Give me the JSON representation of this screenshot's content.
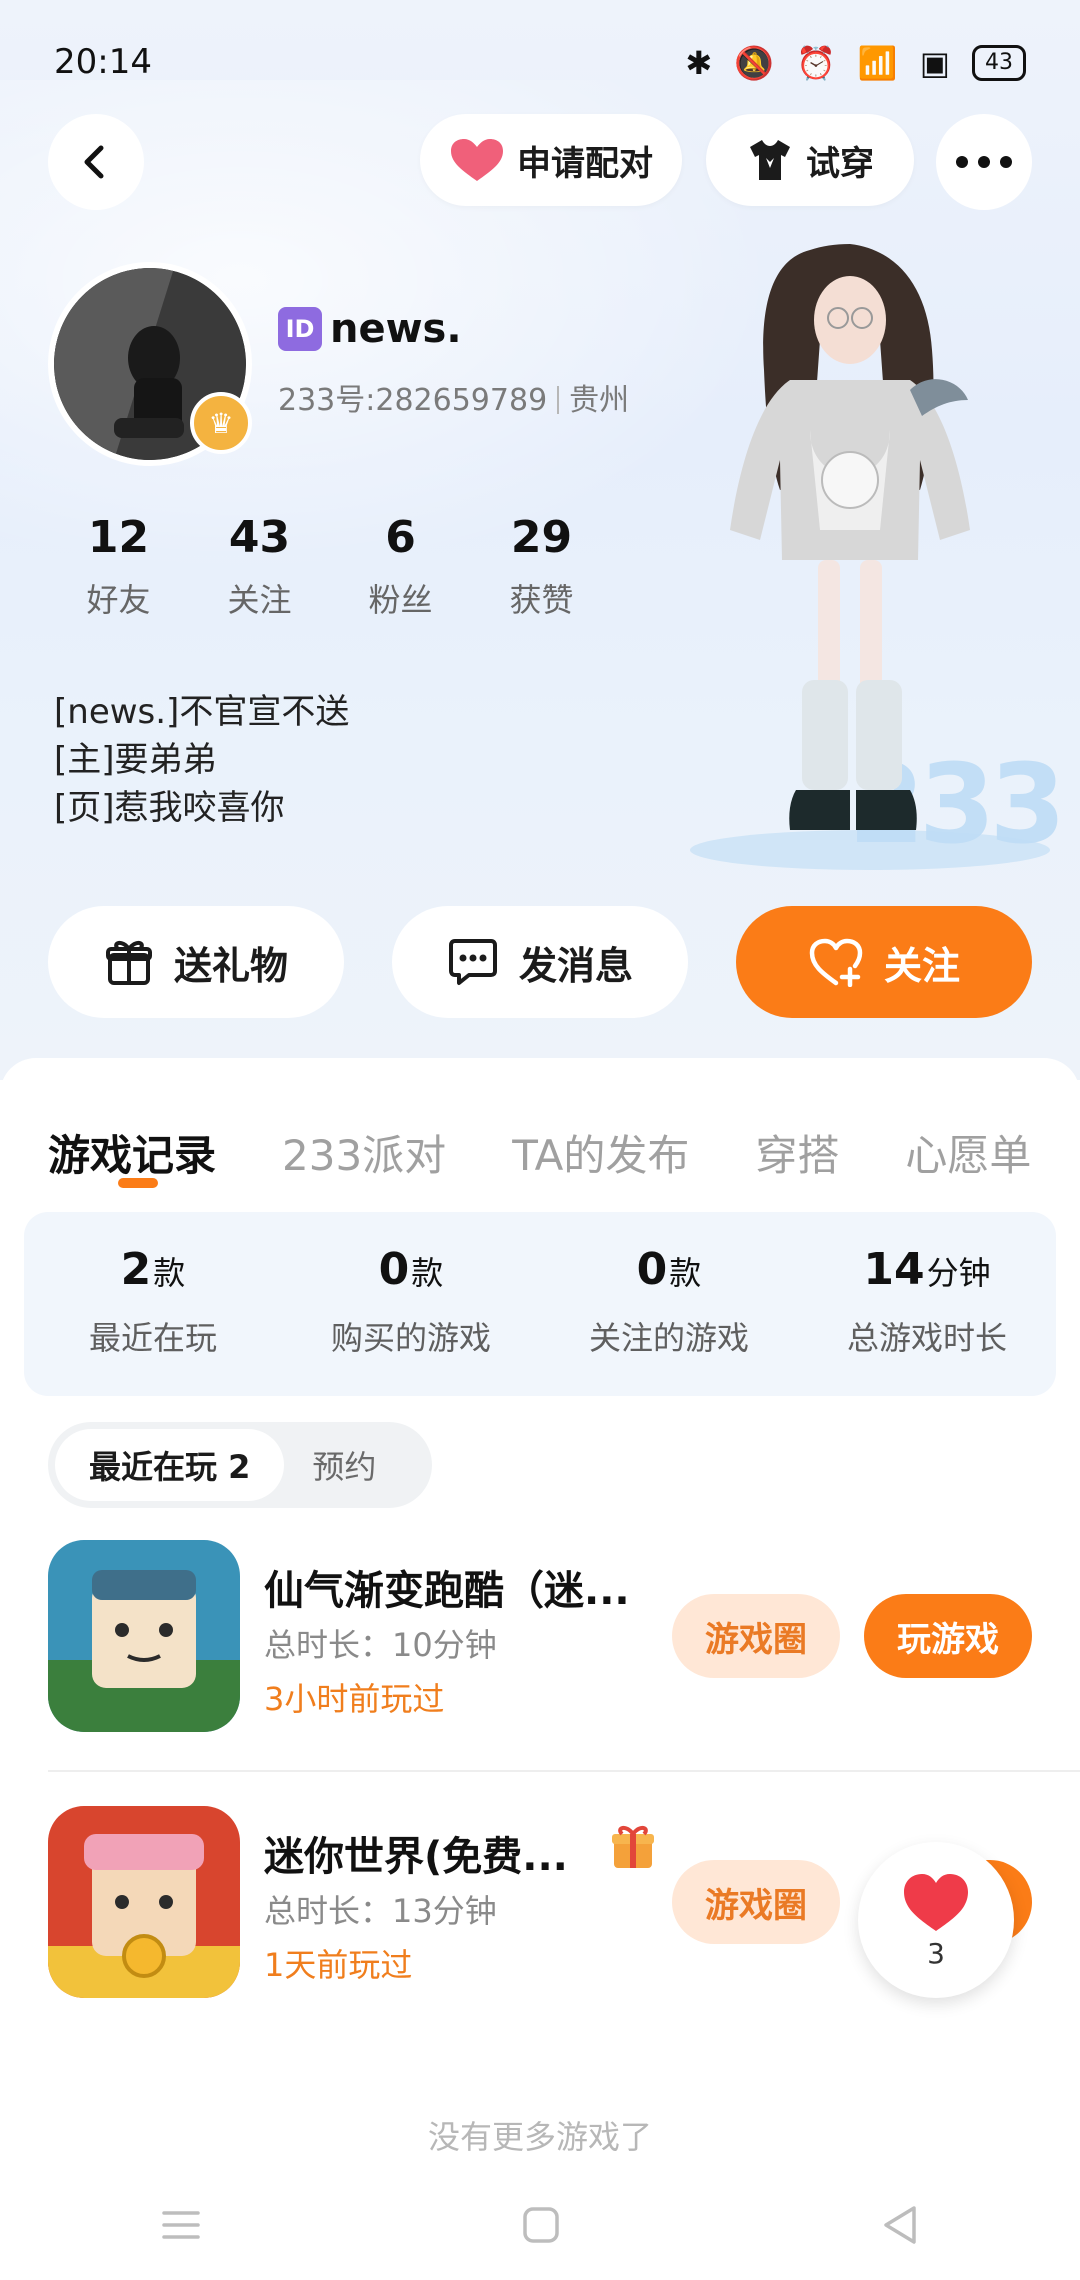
{
  "status": {
    "time": "20:14",
    "battery": "43"
  },
  "top_bar": {
    "pair_label": "申请配对",
    "try_on_label": "试穿"
  },
  "profile": {
    "name": "news.",
    "id_text": "233号:282659789",
    "location": "贵州",
    "id_badge": "ID",
    "stats": [
      {
        "num": "12",
        "label": "好友"
      },
      {
        "num": "43",
        "label": "关注"
      },
      {
        "num": "6",
        "label": "粉丝"
      },
      {
        "num": "29",
        "label": "获赞"
      }
    ],
    "bio_lines": [
      "[news.]不官宣不送",
      "[主]要弟弟",
      "[页]惹我咬喜你"
    ],
    "deco_text": "233"
  },
  "actions": {
    "gift_label": "送礼物",
    "message_label": "发消息",
    "follow_label": "关注"
  },
  "tabs": [
    {
      "label": "游戏记录"
    },
    {
      "label": "233派对"
    },
    {
      "label": "TA的发布"
    },
    {
      "label": "穿搭"
    },
    {
      "label": "心愿单"
    }
  ],
  "summary": [
    {
      "value": "2",
      "unit": "款",
      "label": "最近在玩"
    },
    {
      "value": "0",
      "unit": "款",
      "label": "购买的游戏"
    },
    {
      "value": "0",
      "unit": "款",
      "label": "关注的游戏"
    },
    {
      "value": "14",
      "unit": "分钟",
      "label": "总游戏时长"
    }
  ],
  "filter": {
    "active": "最近在玩 2",
    "other": "预约"
  },
  "games": [
    {
      "title": "仙气渐变跑酷（迷...",
      "duration": "总时长：10分钟",
      "last_played": "3小时前玩过",
      "circle_label": "游戏圈",
      "play_label": "玩游戏"
    },
    {
      "title": "迷你世界(免费...",
      "duration": "总时长：13分钟",
      "last_played": "1天前玩过",
      "circle_label": "游戏圈"
    }
  ],
  "likes": {
    "count": "3"
  },
  "footer": {
    "no_more": "没有更多游戏了"
  },
  "colors": {
    "accent": "#fb7c17",
    "accent_soft": "#ffe7d6",
    "summary_bg": "#f1f6fc"
  }
}
